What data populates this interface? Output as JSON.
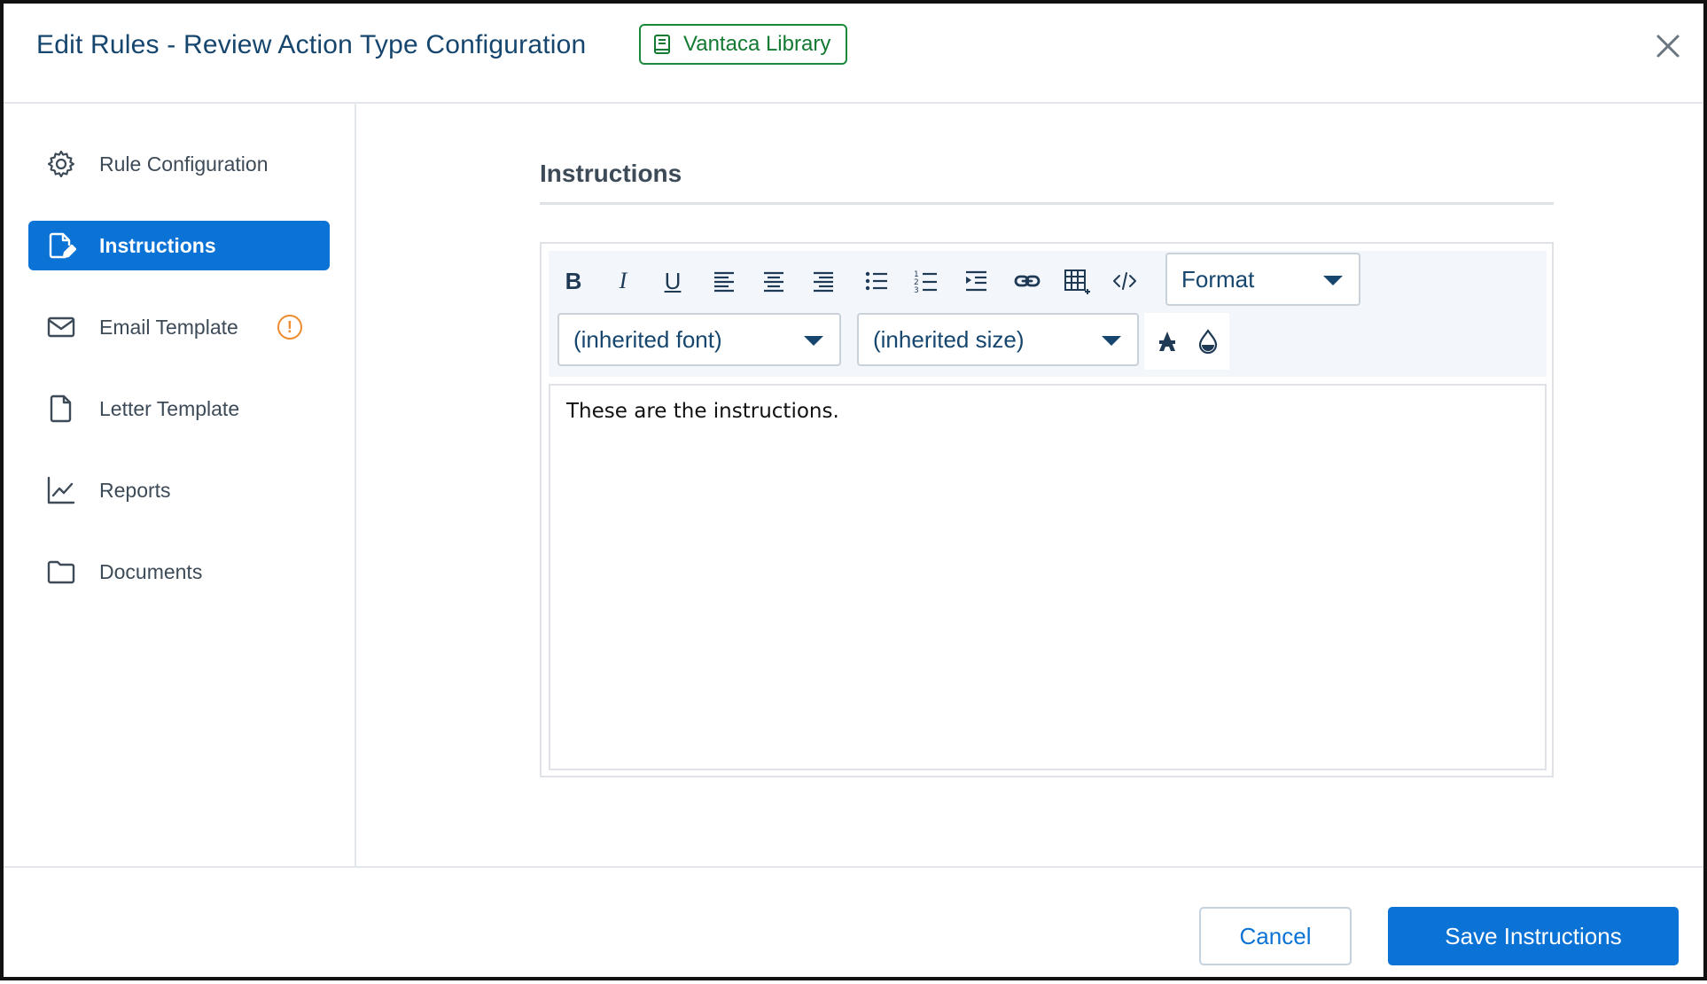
{
  "header": {
    "title": "Edit Rules - Review Action Type Configuration",
    "library_badge": "Vantaca Library",
    "library_icon": "book-icon",
    "close_icon": "close-icon"
  },
  "sidebar": {
    "items": [
      {
        "label": "Rule Configuration",
        "icon": "gear-icon",
        "active": false
      },
      {
        "label": "Instructions",
        "icon": "edit-document-icon",
        "active": true
      },
      {
        "label": "Email Template",
        "icon": "envelope-icon",
        "active": false,
        "badge": "!"
      },
      {
        "label": "Letter Template",
        "icon": "document-icon",
        "active": false
      },
      {
        "label": "Reports",
        "icon": "line-chart-icon",
        "active": false
      },
      {
        "label": "Documents",
        "icon": "folder-icon",
        "active": false
      }
    ]
  },
  "main": {
    "section_title": "Instructions",
    "editor": {
      "toolbar": {
        "bold": "B",
        "italic": "I",
        "underline": "U",
        "format_select": "Format",
        "font_select": "(inherited font)",
        "size_select": "(inherited size)"
      },
      "content": "These are the instructions."
    }
  },
  "footer": {
    "cancel_label": "Cancel",
    "save_label": "Save Instructions"
  },
  "colors": {
    "primary": "#0b72d6",
    "title": "#16466e",
    "library_green": "#137a31",
    "warning": "#f08b2c"
  }
}
